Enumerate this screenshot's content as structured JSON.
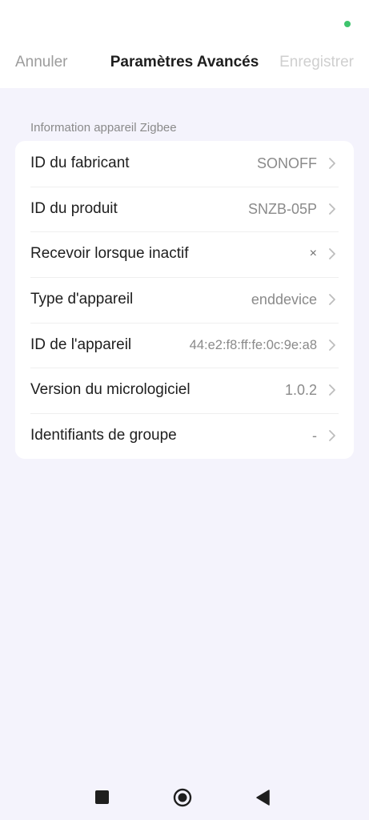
{
  "colors": {
    "status_dot": "#3ec46d",
    "background": "#f4f3fc",
    "text_primary": "#1e1e1e",
    "text_secondary": "#8a8a8a"
  },
  "header": {
    "cancel_label": "Annuler",
    "title": "Paramètres Avancés",
    "save_label": "Enregistrer"
  },
  "section": {
    "label": "Information appareil Zigbee"
  },
  "rows": [
    {
      "label": "ID du fabricant",
      "value": "SONOFF"
    },
    {
      "label": "ID du produit",
      "value": "SNZB-05P"
    },
    {
      "label": "Recevoir lorsque inactif",
      "value": "×"
    },
    {
      "label": "Type d'appareil",
      "value": "enddevice"
    },
    {
      "label": "ID de l'appareil",
      "value": "44:e2:f8:ff:fe:0c:9e:a8"
    },
    {
      "label": "Version du micrologiciel",
      "value": "1.0.2"
    },
    {
      "label": "Identifiants de groupe",
      "value": "-"
    }
  ],
  "icons": {
    "chevron": "chevron-right-icon",
    "nav_recents": "square-icon",
    "nav_home": "circle-icon",
    "nav_back": "triangle-back-icon"
  }
}
